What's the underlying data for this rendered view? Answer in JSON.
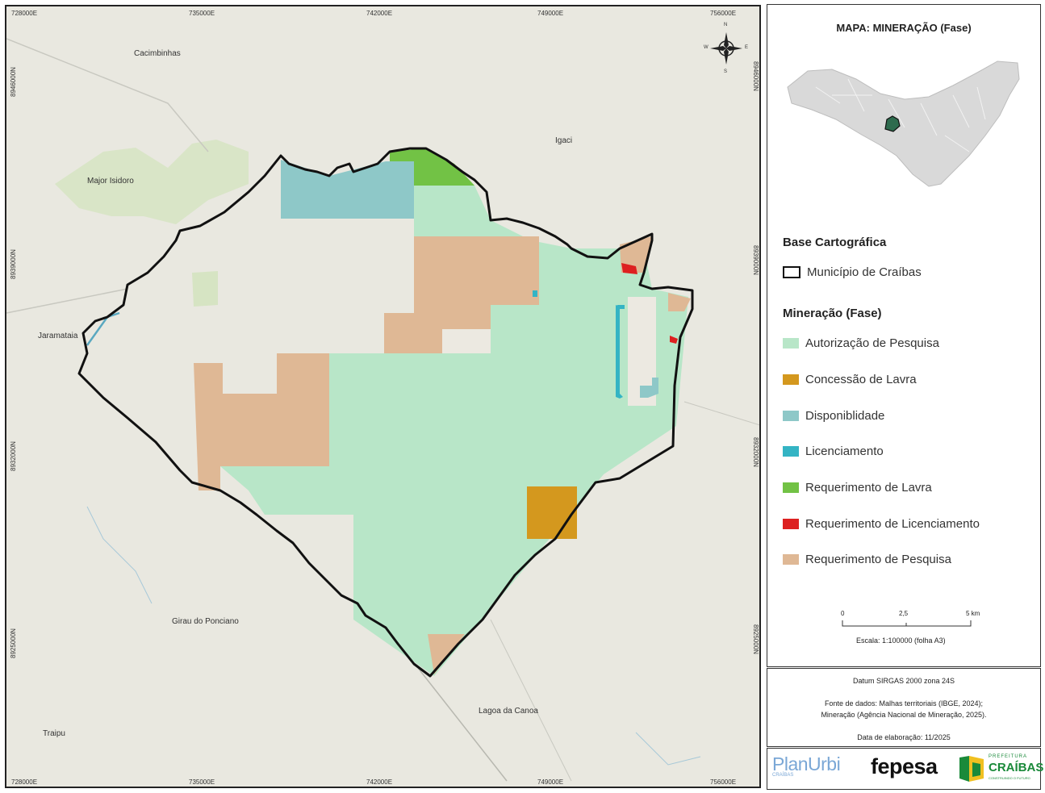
{
  "map": {
    "coords_top": [
      "728000E",
      "735000E",
      "742000E",
      "749000E",
      "756000E"
    ],
    "coords_bottom": [
      "728000E",
      "735000E",
      "742000E",
      "749000E",
      "756000E"
    ],
    "coords_left": [
      "8946000N",
      "8939000N",
      "8932000N",
      "8925000N"
    ],
    "coords_right": [
      "8946000N",
      "8939000N",
      "8932000N",
      "8925000N"
    ],
    "places": [
      "Cacimbinhas",
      "Igaci",
      "Major Isidoro",
      "Jaramataia",
      "Girau do Ponciano",
      "Lagoa da Canoa",
      "Traipu"
    ],
    "compass": {
      "n": "N",
      "s": "S",
      "e": "E",
      "w": "W"
    }
  },
  "panel": {
    "title": "MAPA: MINERAÇÃO (Fase)",
    "base_title": "Base Cartográfica",
    "municipio_label": "Município de Craíbas",
    "legend_title": "Mineração (Fase)",
    "legend": [
      {
        "label": "Autorização de Pesquisa",
        "color": "#b8e6c8"
      },
      {
        "label": "Concessão de Lavra",
        "color": "#d4981e"
      },
      {
        "label": "Disponiblidade",
        "color": "#8ec8c8"
      },
      {
        "label": "Licenciamento",
        "color": "#34b4c4"
      },
      {
        "label": "Requerimento de Lavra",
        "color": "#72c245"
      },
      {
        "label": "Requerimento de Licenciamento",
        "color": "#dd2020"
      },
      {
        "label": "Requerimento de Pesquisa",
        "color": "#dfb895"
      }
    ],
    "scale": {
      "t0": "0",
      "t1": "2,5",
      "t2": "5 km",
      "caption": "Escala: 1:100000 (folha A3)"
    }
  },
  "info": {
    "datum": "Datum SIRGAS 2000 zona 24S",
    "fonte1": "Fonte de dados: Malhas territoriais (IBGE, 2024);",
    "fonte2": "Mineração (Agência Nacional de Mineração, 2025).",
    "data": "Data de elaboração: 11/2025"
  },
  "logos": {
    "planurbi": "PlanUrbi",
    "planurbi_sub": "CRAÍBAS",
    "fepesa": "fepesa",
    "pref_top": "PREFEITURA",
    "craibas": "CRAÍBAS",
    "pref_sub": "CONSTRUINDO O FUTURO"
  },
  "colors": {
    "municipio_outline": "#111111",
    "minimap_fill": "#d9d9d9",
    "minimap_highlight": "#2e6b4e",
    "background": "#e9e8e0"
  }
}
